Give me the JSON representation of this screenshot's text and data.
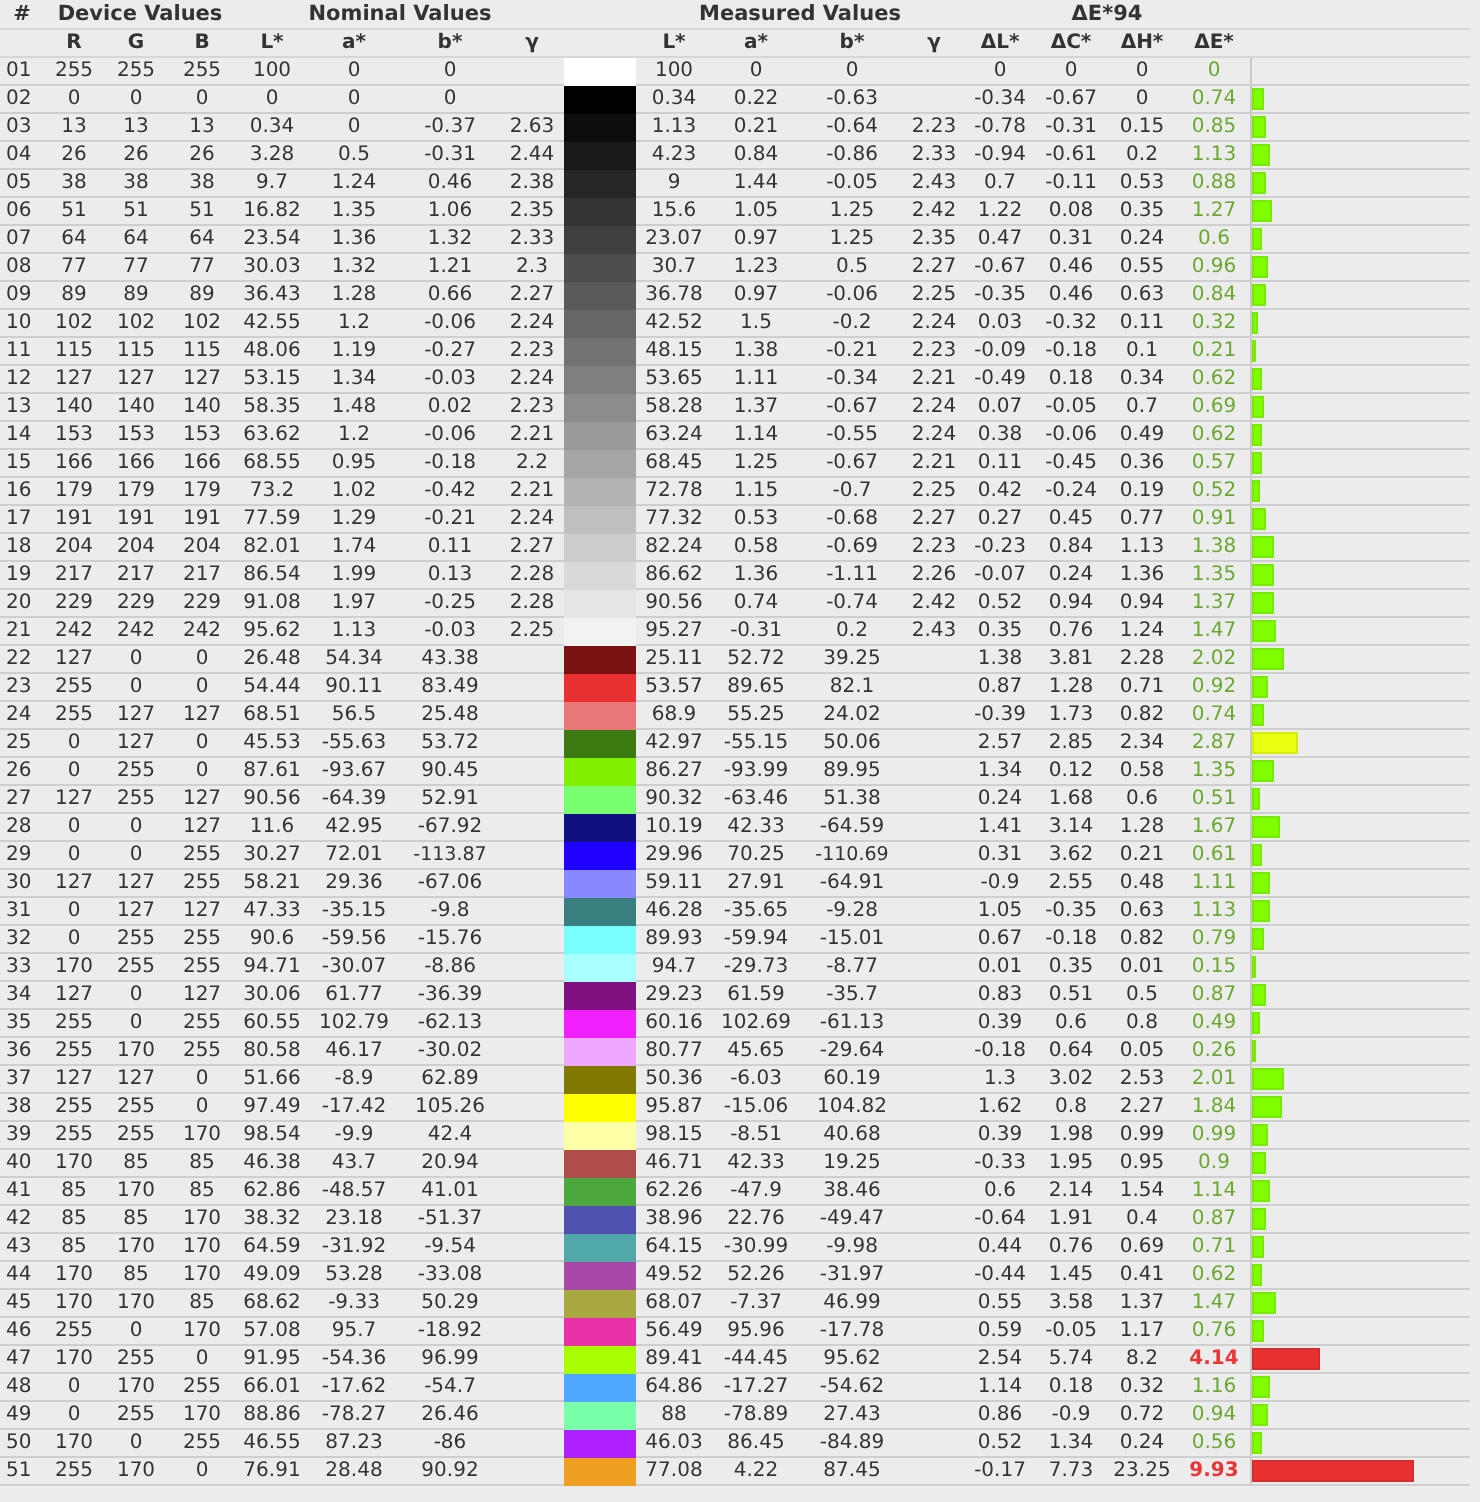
{
  "header": {
    "number": "#",
    "groups": [
      "Device Values",
      "Nominal Values",
      "Measured Values",
      "ΔE*94"
    ]
  },
  "columns": {
    "device": [
      "R",
      "G",
      "B"
    ],
    "nominal": [
      "L*",
      "a*",
      "b*",
      "γ"
    ],
    "measured": [
      "L*",
      "a*",
      "b*",
      "γ"
    ],
    "delta": [
      "ΔL*",
      "ΔC*",
      "ΔH*",
      "ΔE*"
    ]
  },
  "rows": [
    {
      "num": "01",
      "device": [
        "255",
        "255",
        "255"
      ],
      "nominal": [
        "100",
        "0",
        "0"
      ],
      "measured": [
        "100",
        "0",
        "0"
      ],
      "deltas": [
        "0",
        "0",
        "0"
      ],
      "delta_e": "0",
      "kind": "good",
      "color": "#ffffff"
    },
    {
      "num": "02",
      "device": [
        "0",
        "0",
        "0"
      ],
      "nominal": [
        "0",
        "0",
        "0"
      ],
      "measured": [
        "0.34",
        "0.22",
        "-0.63"
      ],
      "deltas": [
        "-0.34",
        "-0.67",
        "0"
      ],
      "delta_e": "0.74",
      "kind": "good",
      "level": 0.055,
      "color": "#000000"
    },
    {
      "num": "03",
      "device": [
        "13",
        "13",
        "13"
      ],
      "nominal": [
        "0.34",
        "0",
        "-0.37"
      ],
      "gamma": "2.63",
      "measured": [
        "1.13",
        "0.21",
        "-0.64"
      ],
      "measured_gamma": "2.23",
      "deltas": [
        "-0.78",
        "-0.31",
        "0.15"
      ],
      "delta_e": "0.85",
      "kind": "good",
      "level": 0.063,
      "color": "#0d0d0d"
    },
    {
      "num": "04",
      "device": [
        "26",
        "26",
        "26"
      ],
      "nominal": [
        "3.28",
        "0.5",
        "-0.31"
      ],
      "gamma": "2.44",
      "measured": [
        "4.23",
        "0.84",
        "-0.86"
      ],
      "measured_gamma": "2.33",
      "deltas": [
        "-0.94",
        "-0.61",
        "0.2"
      ],
      "delta_e": "1.13",
      "kind": "good",
      "level": 0.084,
      "color": "#1a1a1a"
    },
    {
      "num": "05",
      "device": [
        "38",
        "38",
        "38"
      ],
      "nominal": [
        "9.7",
        "1.24",
        "0.46"
      ],
      "gamma": "2.38",
      "measured": [
        "9",
        "1.44",
        "-0.05"
      ],
      "measured_gamma": "2.43",
      "deltas": [
        "0.7",
        "-0.11",
        "0.53"
      ],
      "delta_e": "0.88",
      "kind": "good",
      "level": 0.066,
      "color": "#262626"
    },
    {
      "num": "06",
      "device": [
        "51",
        "51",
        "51"
      ],
      "nominal": [
        "16.82",
        "1.35",
        "1.06"
      ],
      "gamma": "2.35",
      "measured": [
        "15.6",
        "1.05",
        "1.25"
      ],
      "measured_gamma": "2.42",
      "deltas": [
        "1.22",
        "0.08",
        "0.35"
      ],
      "delta_e": "1.27",
      "kind": "good",
      "level": 0.095,
      "color": "#333333"
    },
    {
      "num": "07",
      "device": [
        "64",
        "64",
        "64"
      ],
      "nominal": [
        "23.54",
        "1.36",
        "1.32"
      ],
      "gamma": "2.33",
      "measured": [
        "23.07",
        "0.97",
        "1.25"
      ],
      "measured_gamma": "2.35",
      "deltas": [
        "0.47",
        "0.31",
        "0.24"
      ],
      "delta_e": "0.6",
      "kind": "good",
      "level": 0.045,
      "color": "#404040"
    },
    {
      "num": "08",
      "device": [
        "77",
        "77",
        "77"
      ],
      "nominal": [
        "30.03",
        "1.32",
        "1.21"
      ],
      "gamma": "2.3",
      "measured": [
        "30.7",
        "1.23",
        "0.5"
      ],
      "measured_gamma": "2.27",
      "deltas": [
        "-0.67",
        "0.46",
        "0.55"
      ],
      "delta_e": "0.96",
      "kind": "good",
      "level": 0.072,
      "color": "#4d4d4d"
    },
    {
      "num": "09",
      "device": [
        "89",
        "89",
        "89"
      ],
      "nominal": [
        "36.43",
        "1.28",
        "0.66"
      ],
      "gamma": "2.27",
      "measured": [
        "36.78",
        "0.97",
        "-0.06"
      ],
      "measured_gamma": "2.25",
      "deltas": [
        "-0.35",
        "0.46",
        "0.63"
      ],
      "delta_e": "0.84",
      "kind": "good",
      "level": 0.063,
      "color": "#595959"
    },
    {
      "num": "10",
      "device": [
        "102",
        "102",
        "102"
      ],
      "nominal": [
        "42.55",
        "1.2",
        "-0.06"
      ],
      "gamma": "2.24",
      "measured": [
        "42.52",
        "1.5",
        "-0.2"
      ],
      "measured_gamma": "2.24",
      "deltas": [
        "0.03",
        "-0.32",
        "0.11"
      ],
      "delta_e": "0.32",
      "kind": "good",
      "level": 0.024,
      "color": "#666666"
    },
    {
      "num": "11",
      "device": [
        "115",
        "115",
        "115"
      ],
      "nominal": [
        "48.06",
        "1.19",
        "-0.27"
      ],
      "gamma": "2.23",
      "measured": [
        "48.15",
        "1.38",
        "-0.21"
      ],
      "measured_gamma": "2.23",
      "deltas": [
        "-0.09",
        "-0.18",
        "0.1"
      ],
      "delta_e": "0.21",
      "kind": "good",
      "level": 0.016,
      "color": "#737373"
    },
    {
      "num": "12",
      "device": [
        "127",
        "127",
        "127"
      ],
      "nominal": [
        "53.15",
        "1.34",
        "-0.03"
      ],
      "gamma": "2.24",
      "measured": [
        "53.65",
        "1.11",
        "-0.34"
      ],
      "measured_gamma": "2.21",
      "deltas": [
        "-0.49",
        "0.18",
        "0.34"
      ],
      "delta_e": "0.62",
      "kind": "good",
      "level": 0.046,
      "color": "#7f7f7f"
    },
    {
      "num": "13",
      "device": [
        "140",
        "140",
        "140"
      ],
      "nominal": [
        "58.35",
        "1.48",
        "0.02"
      ],
      "gamma": "2.23",
      "measured": [
        "58.28",
        "1.37",
        "-0.67"
      ],
      "measured_gamma": "2.24",
      "deltas": [
        "0.07",
        "-0.05",
        "0.7"
      ],
      "delta_e": "0.69",
      "kind": "good",
      "level": 0.051,
      "color": "#8c8c8c"
    },
    {
      "num": "14",
      "device": [
        "153",
        "153",
        "153"
      ],
      "nominal": [
        "63.62",
        "1.2",
        "-0.06"
      ],
      "gamma": "2.21",
      "measured": [
        "63.24",
        "1.14",
        "-0.55"
      ],
      "measured_gamma": "2.24",
      "deltas": [
        "0.38",
        "-0.06",
        "0.49"
      ],
      "delta_e": "0.62",
      "kind": "good",
      "level": 0.046,
      "color": "#999999"
    },
    {
      "num": "15",
      "device": [
        "166",
        "166",
        "166"
      ],
      "nominal": [
        "68.55",
        "0.95",
        "-0.18"
      ],
      "gamma": "2.2",
      "measured": [
        "68.45",
        "1.25",
        "-0.67"
      ],
      "measured_gamma": "2.21",
      "deltas": [
        "0.11",
        "-0.45",
        "0.36"
      ],
      "delta_e": "0.57",
      "kind": "good",
      "level": 0.043,
      "color": "#a6a6a6"
    },
    {
      "num": "16",
      "device": [
        "179",
        "179",
        "179"
      ],
      "nominal": [
        "73.2",
        "1.02",
        "-0.42"
      ],
      "gamma": "2.21",
      "measured": [
        "72.78",
        "1.15",
        "-0.7"
      ],
      "measured_gamma": "2.25",
      "deltas": [
        "0.42",
        "-0.24",
        "0.19"
      ],
      "delta_e": "0.52",
      "kind": "good",
      "level": 0.039,
      "color": "#b3b3b3"
    },
    {
      "num": "17",
      "device": [
        "191",
        "191",
        "191"
      ],
      "nominal": [
        "77.59",
        "1.29",
        "-0.21"
      ],
      "gamma": "2.24",
      "measured": [
        "77.32",
        "0.53",
        "-0.68"
      ],
      "measured_gamma": "2.27",
      "deltas": [
        "0.27",
        "0.45",
        "0.77"
      ],
      "delta_e": "0.91",
      "kind": "good",
      "level": 0.068,
      "color": "#bfbfbf"
    },
    {
      "num": "18",
      "device": [
        "204",
        "204",
        "204"
      ],
      "nominal": [
        "82.01",
        "1.74",
        "0.11"
      ],
      "gamma": "2.27",
      "measured": [
        "82.24",
        "0.58",
        "-0.69"
      ],
      "measured_gamma": "2.23",
      "deltas": [
        "-0.23",
        "0.84",
        "1.13"
      ],
      "delta_e": "1.38",
      "kind": "good",
      "level": 0.103,
      "color": "#cccccc"
    },
    {
      "num": "19",
      "device": [
        "217",
        "217",
        "217"
      ],
      "nominal": [
        "86.54",
        "1.99",
        "0.13"
      ],
      "gamma": "2.28",
      "measured": [
        "86.62",
        "1.36",
        "-1.11"
      ],
      "measured_gamma": "2.26",
      "deltas": [
        "-0.07",
        "0.24",
        "1.36"
      ],
      "delta_e": "1.35",
      "kind": "good",
      "level": 0.101,
      "color": "#d9d9d9"
    },
    {
      "num": "20",
      "device": [
        "229",
        "229",
        "229"
      ],
      "nominal": [
        "91.08",
        "1.97",
        "-0.25"
      ],
      "gamma": "2.28",
      "measured": [
        "90.56",
        "0.74",
        "-0.74"
      ],
      "measured_gamma": "2.42",
      "deltas": [
        "0.52",
        "0.94",
        "0.94"
      ],
      "delta_e": "1.37",
      "kind": "good",
      "level": 0.102,
      "color": "#e5e5e5"
    },
    {
      "num": "21",
      "device": [
        "242",
        "242",
        "242"
      ],
      "nominal": [
        "95.62",
        "1.13",
        "-0.03"
      ],
      "gamma": "2.25",
      "measured": [
        "95.27",
        "-0.31",
        "0.2"
      ],
      "measured_gamma": "2.43",
      "deltas": [
        "0.35",
        "0.76",
        "1.24"
      ],
      "delta_e": "1.47",
      "kind": "good",
      "level": 0.11,
      "color": "#f2f2f2"
    },
    {
      "num": "22",
      "device": [
        "127",
        "0",
        "0"
      ],
      "nominal": [
        "26.48",
        "54.34",
        "43.38"
      ],
      "measured": [
        "25.11",
        "52.72",
        "39.25"
      ],
      "deltas": [
        "1.38",
        "3.81",
        "2.28"
      ],
      "delta_e": "2.02",
      "kind": "good",
      "level": 0.151,
      "color": "#7a1414"
    },
    {
      "num": "23",
      "device": [
        "255",
        "0",
        "0"
      ],
      "nominal": [
        "54.44",
        "90.11",
        "83.49"
      ],
      "measured": [
        "53.57",
        "89.65",
        "82.1"
      ],
      "deltas": [
        "0.87",
        "1.28",
        "0.71"
      ],
      "delta_e": "0.92",
      "kind": "good",
      "level": 0.069,
      "color": "#e83030"
    },
    {
      "num": "24",
      "device": [
        "255",
        "127",
        "127"
      ],
      "nominal": [
        "68.51",
        "56.5",
        "25.48"
      ],
      "measured": [
        "68.9",
        "55.25",
        "24.02"
      ],
      "deltas": [
        "-0.39",
        "1.73",
        "0.82"
      ],
      "delta_e": "0.74",
      "kind": "good",
      "level": 0.055,
      "color": "#e87878"
    },
    {
      "num": "25",
      "device": [
        "0",
        "127",
        "0"
      ],
      "nominal": [
        "45.53",
        "-55.63",
        "53.72"
      ],
      "measured": [
        "42.97",
        "-55.15",
        "50.06"
      ],
      "deltas": [
        "2.57",
        "2.85",
        "2.34"
      ],
      "delta_e": "2.87",
      "kind": "fair",
      "level": 0.214,
      "color": "#3a7a10"
    },
    {
      "num": "26",
      "device": [
        "0",
        "255",
        "0"
      ],
      "nominal": [
        "87.61",
        "-93.67",
        "90.45"
      ],
      "measured": [
        "86.27",
        "-93.99",
        "89.95"
      ],
      "deltas": [
        "1.34",
        "0.12",
        "0.58"
      ],
      "delta_e": "1.35",
      "kind": "good",
      "level": 0.101,
      "color": "#80f000"
    },
    {
      "num": "27",
      "device": [
        "127",
        "255",
        "127"
      ],
      "nominal": [
        "90.56",
        "-64.39",
        "52.91"
      ],
      "measured": [
        "90.32",
        "-63.46",
        "51.38"
      ],
      "deltas": [
        "0.24",
        "1.68",
        "0.6"
      ],
      "delta_e": "0.51",
      "kind": "good",
      "level": 0.038,
      "color": "#78ff70"
    },
    {
      "num": "28",
      "device": [
        "0",
        "0",
        "127"
      ],
      "nominal": [
        "11.6",
        "42.95",
        "-67.92"
      ],
      "measured": [
        "10.19",
        "42.33",
        "-64.59"
      ],
      "deltas": [
        "1.41",
        "3.14",
        "1.28"
      ],
      "delta_e": "1.67",
      "kind": "good",
      "level": 0.125,
      "color": "#101080"
    },
    {
      "num": "29",
      "device": [
        "0",
        "0",
        "255"
      ],
      "nominal": [
        "30.27",
        "72.01",
        "-113.87"
      ],
      "measured": [
        "29.96",
        "70.25",
        "-110.69"
      ],
      "deltas": [
        "0.31",
        "3.62",
        "0.21"
      ],
      "delta_e": "0.61",
      "kind": "good",
      "level": 0.046,
      "color": "#2000ff"
    },
    {
      "num": "30",
      "device": [
        "127",
        "127",
        "255"
      ],
      "nominal": [
        "58.21",
        "29.36",
        "-67.06"
      ],
      "measured": [
        "59.11",
        "27.91",
        "-64.91"
      ],
      "deltas": [
        "-0.9",
        "2.55",
        "0.48"
      ],
      "delta_e": "1.11",
      "kind": "good",
      "level": 0.083,
      "color": "#8888ff"
    },
    {
      "num": "31",
      "device": [
        "0",
        "127",
        "127"
      ],
      "nominal": [
        "47.33",
        "-35.15",
        "-9.8"
      ],
      "measured": [
        "46.28",
        "-35.65",
        "-9.28"
      ],
      "deltas": [
        "1.05",
        "-0.35",
        "0.63"
      ],
      "delta_e": "1.13",
      "kind": "good",
      "level": 0.084,
      "color": "#3a7f7f"
    },
    {
      "num": "32",
      "device": [
        "0",
        "255",
        "255"
      ],
      "nominal": [
        "90.6",
        "-59.56",
        "-15.76"
      ],
      "measured": [
        "89.93",
        "-59.94",
        "-15.01"
      ],
      "deltas": [
        "0.67",
        "-0.18",
        "0.82"
      ],
      "delta_e": "0.79",
      "kind": "good",
      "level": 0.059,
      "color": "#78ffff"
    },
    {
      "num": "33",
      "device": [
        "170",
        "255",
        "255"
      ],
      "nominal": [
        "94.71",
        "-30.07",
        "-8.86"
      ],
      "measured": [
        "94.7",
        "-29.73",
        "-8.77"
      ],
      "deltas": [
        "0.01",
        "0.35",
        "0.01"
      ],
      "delta_e": "0.15",
      "kind": "good",
      "level": 0.011,
      "color": "#aaffff"
    },
    {
      "num": "34",
      "device": [
        "127",
        "0",
        "127"
      ],
      "nominal": [
        "30.06",
        "61.77",
        "-36.39"
      ],
      "measured": [
        "29.23",
        "61.59",
        "-35.7"
      ],
      "deltas": [
        "0.83",
        "0.51",
        "0.5"
      ],
      "delta_e": "0.87",
      "kind": "good",
      "level": 0.065,
      "color": "#801080"
    },
    {
      "num": "35",
      "device": [
        "255",
        "0",
        "255"
      ],
      "nominal": [
        "60.55",
        "102.79",
        "-62.13"
      ],
      "measured": [
        "60.16",
        "102.69",
        "-61.13"
      ],
      "deltas": [
        "0.39",
        "0.6",
        "0.8"
      ],
      "delta_e": "0.49",
      "kind": "good",
      "level": 0.037,
      "color": "#f020ff"
    },
    {
      "num": "36",
      "device": [
        "255",
        "170",
        "255"
      ],
      "nominal": [
        "80.58",
        "46.17",
        "-30.02"
      ],
      "measured": [
        "80.77",
        "45.65",
        "-29.64"
      ],
      "deltas": [
        "-0.18",
        "0.64",
        "0.05"
      ],
      "delta_e": "0.26",
      "kind": "good",
      "level": 0.019,
      "color": "#f0a8ff"
    },
    {
      "num": "37",
      "device": [
        "127",
        "127",
        "0"
      ],
      "nominal": [
        "51.66",
        "-8.9",
        "62.89"
      ],
      "measured": [
        "50.36",
        "-6.03",
        "60.19"
      ],
      "deltas": [
        "1.3",
        "3.02",
        "2.53"
      ],
      "delta_e": "2.01",
      "kind": "good",
      "level": 0.15,
      "color": "#807800"
    },
    {
      "num": "38",
      "device": [
        "255",
        "255",
        "0"
      ],
      "nominal": [
        "97.49",
        "-17.42",
        "105.26"
      ],
      "measured": [
        "95.87",
        "-15.06",
        "104.82"
      ],
      "deltas": [
        "1.62",
        "0.8",
        "2.27"
      ],
      "delta_e": "1.84",
      "kind": "good",
      "level": 0.137,
      "color": "#ffff00"
    },
    {
      "num": "39",
      "device": [
        "255",
        "255",
        "170"
      ],
      "nominal": [
        "98.54",
        "-9.9",
        "42.4"
      ],
      "measured": [
        "98.15",
        "-8.51",
        "40.68"
      ],
      "deltas": [
        "0.39",
        "1.98",
        "0.99"
      ],
      "delta_e": "0.99",
      "kind": "good",
      "level": 0.074,
      "color": "#ffffa8"
    },
    {
      "num": "40",
      "device": [
        "170",
        "85",
        "85"
      ],
      "nominal": [
        "46.38",
        "43.7",
        "20.94"
      ],
      "measured": [
        "46.71",
        "42.33",
        "19.25"
      ],
      "deltas": [
        "-0.33",
        "1.95",
        "0.95"
      ],
      "delta_e": "0.9",
      "kind": "good",
      "level": 0.067,
      "color": "#b04c4c"
    },
    {
      "num": "41",
      "device": [
        "85",
        "170",
        "85"
      ],
      "nominal": [
        "62.86",
        "-48.57",
        "41.01"
      ],
      "measured": [
        "62.26",
        "-47.9",
        "38.46"
      ],
      "deltas": [
        "0.6",
        "2.14",
        "1.54"
      ],
      "delta_e": "1.14",
      "kind": "good",
      "level": 0.085,
      "color": "#4ca83c"
    },
    {
      "num": "42",
      "device": [
        "85",
        "85",
        "170"
      ],
      "nominal": [
        "38.32",
        "23.18",
        "-51.37"
      ],
      "measured": [
        "38.96",
        "22.76",
        "-49.47"
      ],
      "deltas": [
        "-0.64",
        "1.91",
        "0.4"
      ],
      "delta_e": "0.87",
      "kind": "good",
      "level": 0.065,
      "color": "#5050b0"
    },
    {
      "num": "43",
      "device": [
        "85",
        "170",
        "170"
      ],
      "nominal": [
        "64.59",
        "-31.92",
        "-9.54"
      ],
      "measured": [
        "64.15",
        "-30.99",
        "-9.98"
      ],
      "deltas": [
        "0.44",
        "0.76",
        "0.69"
      ],
      "delta_e": "0.71",
      "kind": "good",
      "level": 0.053,
      "color": "#50a8a8"
    },
    {
      "num": "44",
      "device": [
        "170",
        "85",
        "170"
      ],
      "nominal": [
        "49.09",
        "53.28",
        "-33.08"
      ],
      "measured": [
        "49.52",
        "52.26",
        "-31.97"
      ],
      "deltas": [
        "-0.44",
        "1.45",
        "0.41"
      ],
      "delta_e": "0.62",
      "kind": "good",
      "level": 0.046,
      "color": "#a848a8"
    },
    {
      "num": "45",
      "device": [
        "170",
        "170",
        "85"
      ],
      "nominal": [
        "68.62",
        "-9.33",
        "50.29"
      ],
      "measured": [
        "68.07",
        "-7.37",
        "46.99"
      ],
      "deltas": [
        "0.55",
        "3.58",
        "1.37"
      ],
      "delta_e": "1.47",
      "kind": "good",
      "level": 0.11,
      "color": "#a8a840"
    },
    {
      "num": "46",
      "device": [
        "255",
        "0",
        "170"
      ],
      "nominal": [
        "57.08",
        "95.7",
        "-18.92"
      ],
      "measured": [
        "56.49",
        "95.96",
        "-17.78"
      ],
      "deltas": [
        "0.59",
        "-0.05",
        "1.17"
      ],
      "delta_e": "0.76",
      "kind": "good",
      "level": 0.057,
      "color": "#e830a8"
    },
    {
      "num": "47",
      "device": [
        "170",
        "255",
        "0"
      ],
      "nominal": [
        "91.95",
        "-54.36",
        "96.99"
      ],
      "measured": [
        "89.41",
        "-44.45",
        "95.62"
      ],
      "deltas": [
        "2.54",
        "5.74",
        "8.2"
      ],
      "delta_e": "4.14",
      "kind": "poor",
      "level": 0.309,
      "color": "#a8ff00"
    },
    {
      "num": "48",
      "device": [
        "0",
        "170",
        "255"
      ],
      "nominal": [
        "66.01",
        "-17.62",
        "-54.7"
      ],
      "measured": [
        "64.86",
        "-17.27",
        "-54.62"
      ],
      "deltas": [
        "1.14",
        "0.18",
        "0.32"
      ],
      "delta_e": "1.16",
      "kind": "good",
      "level": 0.087,
      "color": "#50a8ff"
    },
    {
      "num": "49",
      "device": [
        "0",
        "255",
        "170"
      ],
      "nominal": [
        "88.86",
        "-78.27",
        "26.46"
      ],
      "measured": [
        "88",
        "-78.89",
        "27.43"
      ],
      "deltas": [
        "0.86",
        "-0.9",
        "0.72"
      ],
      "delta_e": "0.94",
      "kind": "good",
      "level": 0.07,
      "color": "#78ffa8"
    },
    {
      "num": "50",
      "device": [
        "170",
        "0",
        "255"
      ],
      "nominal": [
        "46.55",
        "87.23",
        "-86"
      ],
      "measured": [
        "46.03",
        "86.45",
        "-84.89"
      ],
      "deltas": [
        "0.52",
        "1.34",
        "0.24"
      ],
      "delta_e": "0.56",
      "kind": "good",
      "level": 0.042,
      "color": "#b020ff"
    },
    {
      "num": "51",
      "device": [
        "255",
        "170",
        "0"
      ],
      "nominal": [
        "76.91",
        "28.48",
        "90.92"
      ],
      "measured": [
        "77.08",
        "4.22",
        "87.45"
      ],
      "deltas": [
        "-0.17",
        "7.73",
        "23.25"
      ],
      "delta_e": "9.93",
      "kind": "poor",
      "level": 0.741,
      "color": "#f0a020"
    }
  ]
}
